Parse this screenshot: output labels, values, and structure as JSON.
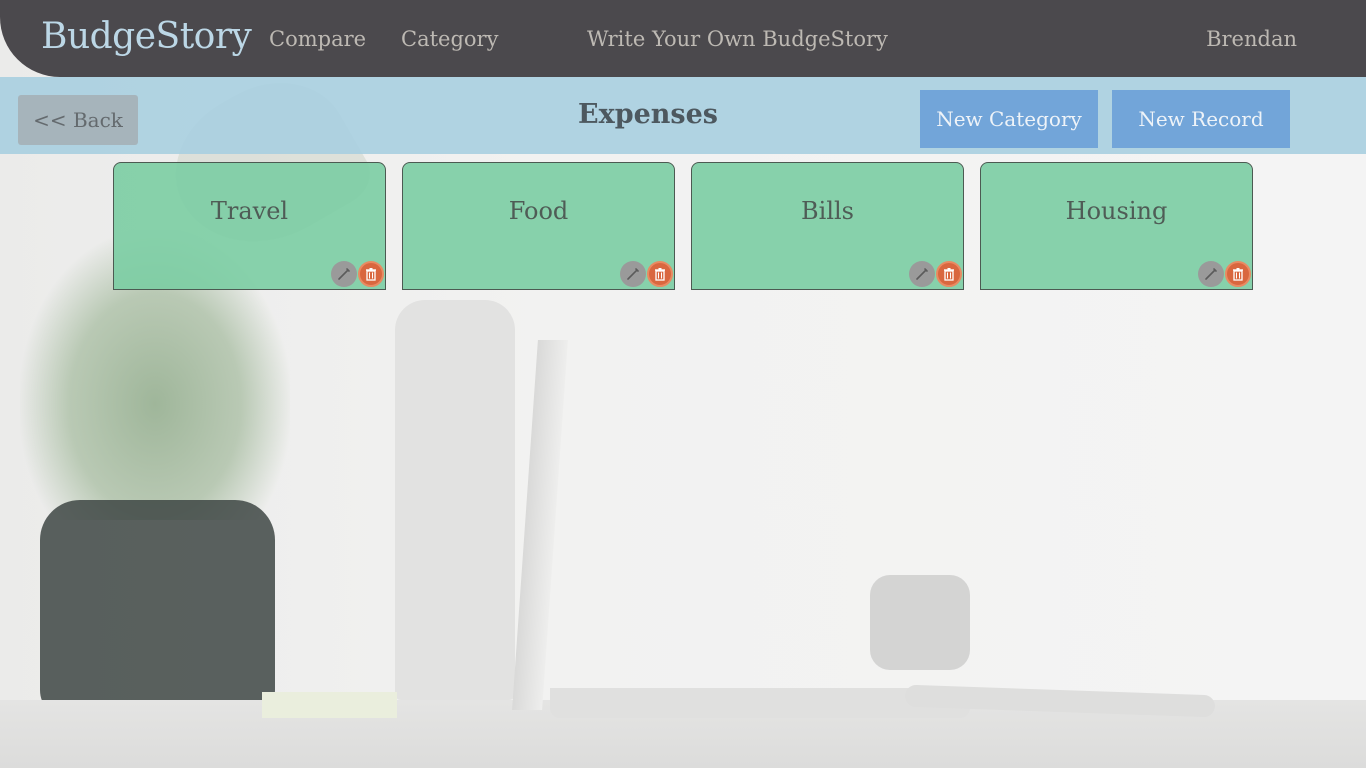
{
  "header": {
    "brand": "BudgeStory",
    "nav": {
      "compare": "Compare",
      "category": "Category",
      "write": "Write Your Own BudgeStory"
    },
    "user": "Brendan"
  },
  "toolbar": {
    "back_label": "<< Back",
    "title": "Expenses",
    "new_category_label": "New Category",
    "new_record_label": "New Record"
  },
  "categories": [
    {
      "name": "Travel"
    },
    {
      "name": "Food"
    },
    {
      "name": "Bills"
    },
    {
      "name": "Housing"
    }
  ],
  "colors": {
    "topbar": "#4b494d",
    "brand": "#bcd7e6",
    "subbar": "#a8cfe0",
    "button_blue": "#72a5d9",
    "card_green": "#7bcda3",
    "delete_red": "#d9673f"
  },
  "icons": {
    "edit": "pencil-icon",
    "delete": "trash-icon"
  }
}
